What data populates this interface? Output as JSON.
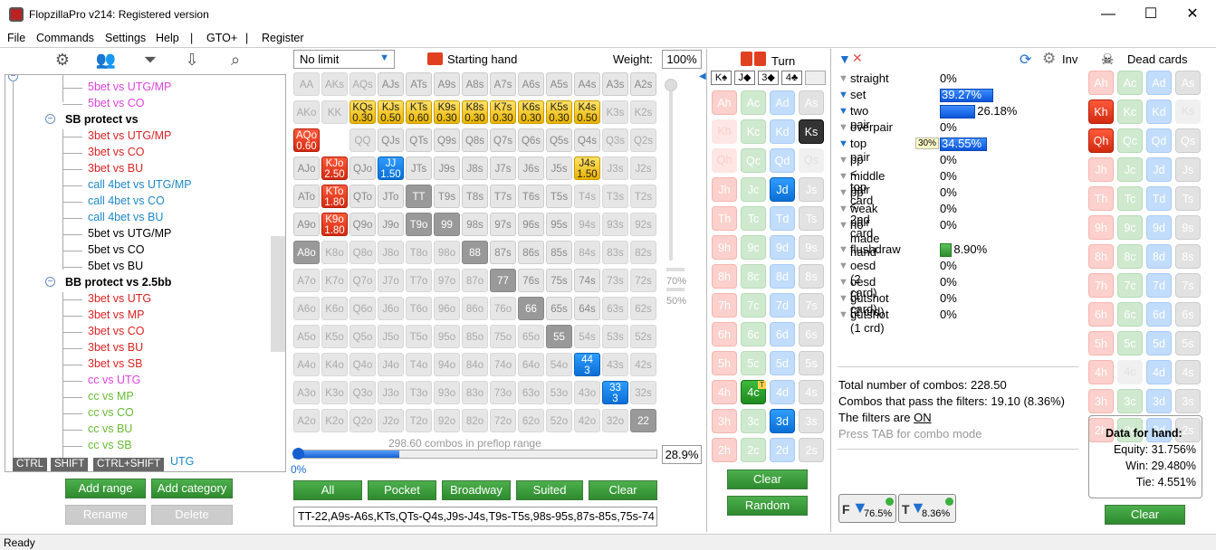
{
  "window": {
    "title": "FlopzillaPro v214: Registered version",
    "minimize": "—",
    "maximize": "☐",
    "close": "✕"
  },
  "menu": {
    "file": "File",
    "commands": "Commands",
    "settings": "Settings",
    "help": "Help",
    "sep1": "|",
    "gto": "GTO+",
    "sep2": "|",
    "register": "Register"
  },
  "tree": {
    "items": [
      {
        "label": "5bet vs UTG/MP",
        "color": "#dd44dd"
      },
      {
        "label": "5bet vs CO",
        "color": "#dd44dd"
      },
      {
        "label": "SB protect vs",
        "color": "#000000"
      },
      {
        "label": "3bet vs UTG/MP",
        "color": "#dd2222"
      },
      {
        "label": "3bet vs CO",
        "color": "#dd2222"
      },
      {
        "label": "3bet vs BU",
        "color": "#dd2222"
      },
      {
        "label": "call 4bet vs UTG/MP",
        "color": "#1e88c8"
      },
      {
        "label": "call 4bet vs CO",
        "color": "#1e88c8"
      },
      {
        "label": "call 4bet vs BU",
        "color": "#1e88c8"
      },
      {
        "label": "5bet vs UTG/MP",
        "color": "#000000"
      },
      {
        "label": "5bet vs CO",
        "color": "#000000"
      },
      {
        "label": "5bet vs BU",
        "color": "#000000"
      },
      {
        "label": "BB protect vs 2.5bb",
        "color": "#000000"
      },
      {
        "label": "3bet vs UTG",
        "color": "#dd2222"
      },
      {
        "label": "3bet vs MP",
        "color": "#dd2222"
      },
      {
        "label": "3bet vs CO",
        "color": "#dd2222"
      },
      {
        "label": "3bet vs BU",
        "color": "#dd2222"
      },
      {
        "label": "3bet vs SB",
        "color": "#dd2222"
      },
      {
        "label": "cc vs UTG",
        "color": "#dd44dd"
      },
      {
        "label": "cc vs MP",
        "color": "#66bb33"
      },
      {
        "label": "cc vs CO",
        "color": "#66bb33"
      },
      {
        "label": "cc vs BU",
        "color": "#66bb33"
      },
      {
        "label": "cc vs SB",
        "color": "#66bb33"
      },
      {
        "label": "UTG",
        "color": "#1e88c8"
      }
    ],
    "hint_ctrl": "CTRL",
    "hint_shift": "SHIFT",
    "hint_ctrlshift": "CTRL+SHIFT",
    "add_range": "Add range",
    "add_category": "Add category",
    "rename": "Rename",
    "delete": "Delete"
  },
  "range": {
    "limit": "No limit",
    "starting_hand": "Starting hand",
    "weight_label": "Weight:",
    "weight_value": "100%",
    "slider_70": "70%",
    "slider_50": "50%",
    "combos_text": "298.60 combos in preflop range",
    "progress_left": "0%",
    "progress_pct": "28.9%",
    "progress_fraction": 0.289,
    "btn_all": "All",
    "btn_pocket": "Pocket",
    "btn_broadway": "Broadway",
    "btn_suited": "Suited",
    "btn_clear": "Clear",
    "range_text": "TT-22,A9s-A6s,KTs,QTs-Q4s,J9s-J4s,T9s-T5s,98s-95s,87s-85s,75s-74",
    "grid": [
      [
        [
          "AA",
          "e"
        ],
        [
          "AKs",
          "e"
        ],
        [
          "AQs",
          "e"
        ],
        [
          "AJs",
          "l"
        ],
        [
          "ATs",
          "l"
        ],
        [
          "A9s",
          "l"
        ],
        [
          "A8s",
          "l"
        ],
        [
          "A7s",
          "l"
        ],
        [
          "A6s",
          "l"
        ],
        [
          "A5s",
          "l"
        ],
        [
          "A4s",
          "l"
        ],
        [
          "A3s",
          "l"
        ],
        [
          "A2s",
          "l"
        ]
      ],
      [
        [
          "AKo",
          "e"
        ],
        [
          "KK",
          "e"
        ],
        [
          "KQs",
          "y",
          "0.30"
        ],
        [
          "KJs",
          "y",
          "0.50"
        ],
        [
          "KTs",
          "y",
          "0.60"
        ],
        [
          "K9s",
          "y",
          "0.30"
        ],
        [
          "K8s",
          "y",
          "0.30"
        ],
        [
          "K7s",
          "y",
          "0.30"
        ],
        [
          "K6s",
          "y",
          "0.30"
        ],
        [
          "K5s",
          "y",
          "0.30"
        ],
        [
          "K4s",
          "y",
          "0.50"
        ],
        [
          "K3s",
          "e"
        ],
        [
          "K2s",
          "e"
        ]
      ],
      [
        [
          "AQo",
          "r",
          "0.60"
        ],
        [
          "QQ",
          "e"
        ],
        [
          "QJs",
          "l"
        ],
        [
          "QTs",
          "l"
        ],
        [
          "Q9s",
          "l"
        ],
        [
          "Q8s",
          "l"
        ],
        [
          "Q7s",
          "l"
        ],
        [
          "Q6s",
          "l"
        ],
        [
          "Q5s",
          "l"
        ],
        [
          "Q4s",
          "l"
        ],
        [
          "Q3s",
          "e"
        ],
        [
          "Q2s",
          "e"
        ]
      ],
      [
        [
          "AJo",
          "l"
        ],
        [
          "KJo",
          "r",
          "2.50"
        ],
        [
          "QJo",
          "l"
        ],
        [
          "JJ",
          "b",
          "1.50"
        ],
        [
          "JTs",
          "l"
        ],
        [
          "J9s",
          "l"
        ],
        [
          "J8s",
          "l"
        ],
        [
          "J7s",
          "l"
        ],
        [
          "J6s",
          "l"
        ],
        [
          "J5s",
          "l"
        ],
        [
          "J4s",
          "y",
          "1.50"
        ],
        [
          "J3s",
          "e"
        ],
        [
          "J2s",
          "e"
        ]
      ],
      [
        [
          "ATo",
          "l"
        ],
        [
          "KTo",
          "r",
          "1.80"
        ],
        [
          "QTo",
          "l"
        ],
        [
          "JTo",
          "l"
        ],
        [
          "TT",
          "g"
        ],
        [
          "T9s",
          "l"
        ],
        [
          "T8s",
          "l"
        ],
        [
          "T7s",
          "l"
        ],
        [
          "T6s",
          "l"
        ],
        [
          "T5s",
          "l"
        ],
        [
          "T4s",
          "e"
        ],
        [
          "T3s",
          "e"
        ],
        [
          "T2s",
          "e"
        ]
      ],
      [
        [
          "A9o",
          "l"
        ],
        [
          "K9o",
          "r",
          "1.80"
        ],
        [
          "Q9o",
          "l"
        ],
        [
          "J9o",
          "l"
        ],
        [
          "T9o",
          "g"
        ],
        [
          "99",
          "g"
        ],
        [
          "98s",
          "l"
        ],
        [
          "97s",
          "l"
        ],
        [
          "96s",
          "l"
        ],
        [
          "95s",
          "l"
        ],
        [
          "94s",
          "e"
        ],
        [
          "93s",
          "e"
        ],
        [
          "92s",
          "e"
        ]
      ],
      [
        [
          "A8o",
          "g"
        ],
        [
          "K8o",
          "e"
        ],
        [
          "Q8o",
          "e"
        ],
        [
          "J8o",
          "e"
        ],
        [
          "T8o",
          "e"
        ],
        [
          "98o",
          "e"
        ],
        [
          "88",
          "g"
        ],
        [
          "87s",
          "l"
        ],
        [
          "86s",
          "l"
        ],
        [
          "85s",
          "l"
        ],
        [
          "84s",
          "e"
        ],
        [
          "83s",
          "e"
        ],
        [
          "82s",
          "e"
        ]
      ],
      [
        [
          "A7o",
          "e"
        ],
        [
          "K7o",
          "e"
        ],
        [
          "Q7o",
          "e"
        ],
        [
          "J7o",
          "e"
        ],
        [
          "T7o",
          "e"
        ],
        [
          "97o",
          "e"
        ],
        [
          "87o",
          "e"
        ],
        [
          "77",
          "g"
        ],
        [
          "76s",
          "l"
        ],
        [
          "75s",
          "l"
        ],
        [
          "74s",
          "l"
        ],
        [
          "73s",
          "e"
        ],
        [
          "72s",
          "e"
        ]
      ],
      [
        [
          "A6o",
          "e"
        ],
        [
          "K6o",
          "e"
        ],
        [
          "Q6o",
          "e"
        ],
        [
          "J6o",
          "e"
        ],
        [
          "T6o",
          "e"
        ],
        [
          "96o",
          "e"
        ],
        [
          "86o",
          "e"
        ],
        [
          "76o",
          "e"
        ],
        [
          "66",
          "g"
        ],
        [
          "65s",
          "l"
        ],
        [
          "64s",
          "l"
        ],
        [
          "63s",
          "e"
        ],
        [
          "62s",
          "e"
        ]
      ],
      [
        [
          "A5o",
          "e"
        ],
        [
          "K5o",
          "e"
        ],
        [
          "Q5o",
          "e"
        ],
        [
          "J5o",
          "e"
        ],
        [
          "T5o",
          "e"
        ],
        [
          "95o",
          "e"
        ],
        [
          "85o",
          "e"
        ],
        [
          "75o",
          "e"
        ],
        [
          "65o",
          "e"
        ],
        [
          "55",
          "g"
        ],
        [
          "54s",
          "e"
        ],
        [
          "53s",
          "e"
        ],
        [
          "52s",
          "e"
        ]
      ],
      [
        [
          "A4o",
          "e"
        ],
        [
          "K4o",
          "e"
        ],
        [
          "Q4o",
          "e"
        ],
        [
          "J4o",
          "e"
        ],
        [
          "T4o",
          "e"
        ],
        [
          "94o",
          "e"
        ],
        [
          "84o",
          "e"
        ],
        [
          "74o",
          "e"
        ],
        [
          "64o",
          "e"
        ],
        [
          "54o",
          "e"
        ],
        [
          "44",
          "b",
          "3"
        ],
        [
          "43s",
          "e"
        ],
        [
          "42s",
          "e"
        ]
      ],
      [
        [
          "A3o",
          "e"
        ],
        [
          "K3o",
          "e"
        ],
        [
          "Q3o",
          "e"
        ],
        [
          "J3o",
          "e"
        ],
        [
          "T3o",
          "e"
        ],
        [
          "93o",
          "e"
        ],
        [
          "83o",
          "e"
        ],
        [
          "73o",
          "e"
        ],
        [
          "63o",
          "e"
        ],
        [
          "53o",
          "e"
        ],
        [
          "43o",
          "e"
        ],
        [
          "33",
          "b",
          "3"
        ],
        [
          "32s",
          "e"
        ]
      ],
      [
        [
          "A2o",
          "e"
        ],
        [
          "K2o",
          "e"
        ],
        [
          "Q2o",
          "e"
        ],
        [
          "J2o",
          "e"
        ],
        [
          "T2o",
          "e"
        ],
        [
          "92o",
          "e"
        ],
        [
          "82o",
          "e"
        ],
        [
          "72o",
          "e"
        ],
        [
          "62o",
          "e"
        ],
        [
          "52o",
          "e"
        ],
        [
          "42o",
          "e"
        ],
        [
          "32o",
          "e"
        ],
        [
          "22",
          "g"
        ]
      ]
    ]
  },
  "board": {
    "title": "Turn",
    "slots": [
      "K♠",
      "J◆",
      "3◆",
      "4♣"
    ],
    "clear": "Clear",
    "random": "Random",
    "ranks": [
      "A",
      "K",
      "Q",
      "J",
      "T",
      "9",
      "8",
      "7",
      "6",
      "5",
      "4",
      "3",
      "2"
    ]
  },
  "stats": {
    "inv": "Inv",
    "rows": [
      {
        "label": "straight",
        "pct": "0%",
        "bar": 0,
        "type": "none"
      },
      {
        "label": "set",
        "pct": "39.27%",
        "bar": 39.27,
        "type": "blue"
      },
      {
        "label": "two pair",
        "pct": "26.18%",
        "bar": 26.18,
        "type": "blue"
      },
      {
        "label": "overpair",
        "pct": "0%",
        "bar": 0,
        "type": "none"
      },
      {
        "label": "top pair",
        "pct": "34.55%",
        "bar": 34.55,
        "type": "blue",
        "badge": "30%"
      },
      {
        "label": "pp < top card",
        "pct": "0%",
        "bar": 0,
        "type": "none"
      },
      {
        "label": "middle pair",
        "pct": "0%",
        "bar": 0,
        "type": "none"
      },
      {
        "label": "pp < 2nd card",
        "pct": "0%",
        "bar": 0,
        "type": "none"
      },
      {
        "label": "weak pair",
        "pct": "0%",
        "bar": 0,
        "type": "none"
      },
      {
        "label": "no made hand",
        "pct": "0%",
        "bar": 0,
        "type": "none"
      }
    ],
    "draws": [
      {
        "label": "flushdraw",
        "pct": "8.90%",
        "bar": 8.9,
        "type": "green"
      },
      {
        "label": "oesd (2 card)",
        "pct": "0%",
        "bar": 0,
        "type": "none"
      },
      {
        "label": "oesd (1 card)",
        "pct": "0%",
        "bar": 0,
        "type": "none"
      },
      {
        "label": "gutshot (2 crd)",
        "pct": "0%",
        "bar": 0,
        "type": "none"
      },
      {
        "label": "gutshot (1 crd)",
        "pct": "0%",
        "bar": 0,
        "type": "none"
      }
    ],
    "total_combos": "Total number of combos: 228.50",
    "pass_filters": "Combos that pass the filters: 19.10 (8.36%)",
    "filters_are": "The filters are",
    "filters_state": "ON",
    "press_tab": "Press TAB for combo mode",
    "f_btn": "76.5%",
    "t_btn": "8.36%"
  },
  "dead": {
    "title": "Dead cards",
    "clear": "Clear",
    "data_title": "Data for hand:",
    "equity": "Equity: 31.756%",
    "win": "Win: 29.480%",
    "tie": "Tie: 4.551%"
  },
  "status": {
    "ready": "Ready"
  }
}
